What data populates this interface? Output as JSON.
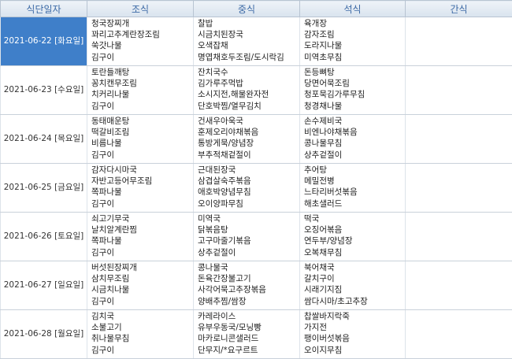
{
  "headers": [
    "식단일자",
    "조식",
    "중식",
    "석식",
    "간식"
  ],
  "rows": [
    {
      "date": "2021-06-22 [화요일]",
      "breakfast": [
        "청국장찌개",
        "꽈리고추계란장조림",
        "쑥갓나물",
        "김구이"
      ],
      "lunch": [
        "찰밥",
        "시금치된장국",
        "오색잡채",
        "명엽채호두조림/도시락김"
      ],
      "dinner": [
        "육개장",
        "감자조림",
        "도라지나물",
        "미역초무침"
      ],
      "snack": []
    },
    {
      "date": "2021-06-23 [수요일]",
      "breakfast": [
        "토란들깨탕",
        "꽁치캔무조림",
        "치커리나물",
        "김구이"
      ],
      "lunch": [
        "잔치국수",
        "김가루주먹밥",
        "소시지전,해물완자전",
        "단호박찜/열무김치"
      ],
      "dinner": [
        "돈등뼈탕",
        "당면어묵조림",
        "청포묵김가루무침",
        "청경채나물"
      ],
      "snack": []
    },
    {
      "date": "2021-06-24 [목요일]",
      "breakfast": [
        "동태매운탕",
        "떡갈비조림",
        "비름나물",
        "김구이"
      ],
      "lunch": [
        "건새우아욱국",
        "훈제오리야채볶음",
        "통방게묵/양념장",
        "부추적채겉절이"
      ],
      "dinner": [
        "손수제비국",
        "비엔나야채볶음",
        "콩나물무침",
        "상추겉절이"
      ],
      "snack": []
    },
    {
      "date": "2021-06-25 [금요일]",
      "breakfast": [
        "감자다시마국",
        "자반고등어무조림",
        "쪽파나물",
        "김구이"
      ],
      "lunch": [
        "근대된장국",
        "삼겹살숙주볶음",
        "애호박양념무침",
        "오이양파무침"
      ],
      "dinner": [
        "추어탕",
        "메밀전병",
        "느타리버섯볶음",
        "해초샐러드"
      ],
      "snack": []
    },
    {
      "date": "2021-06-26 [토요일]",
      "breakfast": [
        "쇠고기무국",
        "날치알계란찜",
        "쪽파나물",
        "김구이"
      ],
      "lunch": [
        "미역국",
        "닭볶음탕",
        "고구마줄기볶음",
        "상추겉절이"
      ],
      "dinner": [
        "떡국",
        "오징어볶음",
        "연두부/양념장",
        "오복채무침"
      ],
      "snack": []
    },
    {
      "date": "2021-06-27 [일요일]",
      "breakfast": [
        "버섯된장찌개",
        "삼치무조림",
        "시금치나물",
        "김구이"
      ],
      "lunch": [
        "콩나물국",
        "돈육간장불고기",
        "사각어묵고추장볶음",
        "양배추찜/쌈장"
      ],
      "dinner": [
        "북어채국",
        "갈치구이",
        "시래기지짐",
        "쌈다시마/초고추장"
      ],
      "snack": []
    },
    {
      "date": "2021-06-28 [월요일]",
      "breakfast": [
        "김치국",
        "소불고기",
        "취나물무침",
        "김구이"
      ],
      "lunch": [
        "카레라이스",
        "유부우동국/모닝빵",
        "마카로니콘샐러드",
        "단무지/*요구르트"
      ],
      "dinner": [
        "찹쌀바지락죽",
        "가지전",
        "팽이버섯볶음",
        "오이지무침"
      ],
      "snack": []
    }
  ],
  "selected_row": 0,
  "colors": {
    "header_text": "#3c6aa6",
    "selected_bg": "#3f7fc9",
    "selected_text": "#ffffff"
  }
}
